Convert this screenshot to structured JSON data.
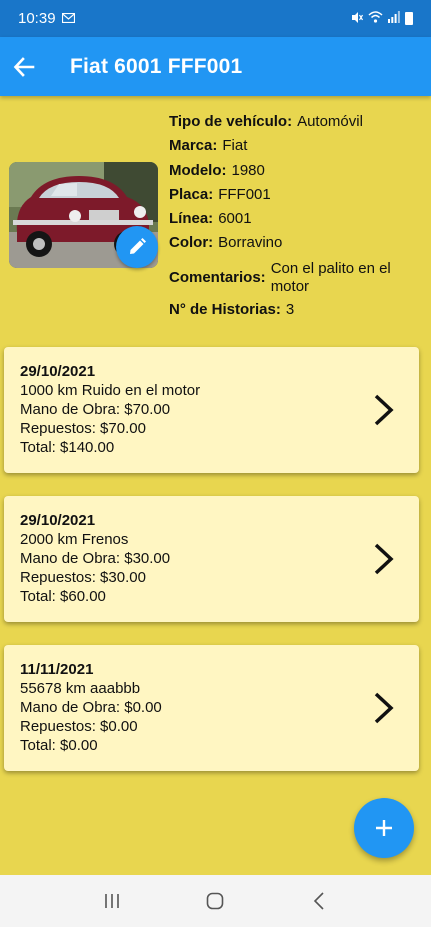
{
  "status": {
    "time": "10:39",
    "left_icon": "gmail-icon",
    "right_icons": [
      "mute-icon",
      "wifi-icon",
      "signal-icon",
      "battery-icon"
    ]
  },
  "app_bar": {
    "title": "Fiat 6001 FFF001"
  },
  "vehicle": {
    "fields": [
      {
        "label": "Tipo de vehículo:",
        "value": "Automóvil"
      },
      {
        "label": "Marca:",
        "value": "Fiat"
      },
      {
        "label": "Modelo:",
        "value": "1980"
      },
      {
        "label": "Placa:",
        "value": "FFF001"
      },
      {
        "label": "Línea:",
        "value": "6001"
      },
      {
        "label": "Color:",
        "value": "Borravino"
      },
      {
        "label": "Comentarios:",
        "value": "Con el palito en el motor"
      },
      {
        "label": "N° de Historias:",
        "value": "3"
      }
    ]
  },
  "histories": [
    {
      "date": "29/10/2021",
      "desc": "1000 km Ruido en el motor",
      "labor": "Mano de Obra: $70.00",
      "parts": "Repuestos: $70.00",
      "total": "Total: $140.00"
    },
    {
      "date": "29/10/2021",
      "desc": "2000 km Frenos",
      "labor": "Mano de Obra: $30.00",
      "parts": "Repuestos: $30.00",
      "total": "Total: $60.00"
    },
    {
      "date": "11/11/2021",
      "desc": "55678 km aaabbb",
      "labor": "Mano de Obra: $0.00",
      "parts": "Repuestos: $0.00",
      "total": "Total: $0.00"
    }
  ],
  "colors": {
    "background": "#e8d64f",
    "primary": "#2196f3",
    "card": "#fff6c2"
  }
}
